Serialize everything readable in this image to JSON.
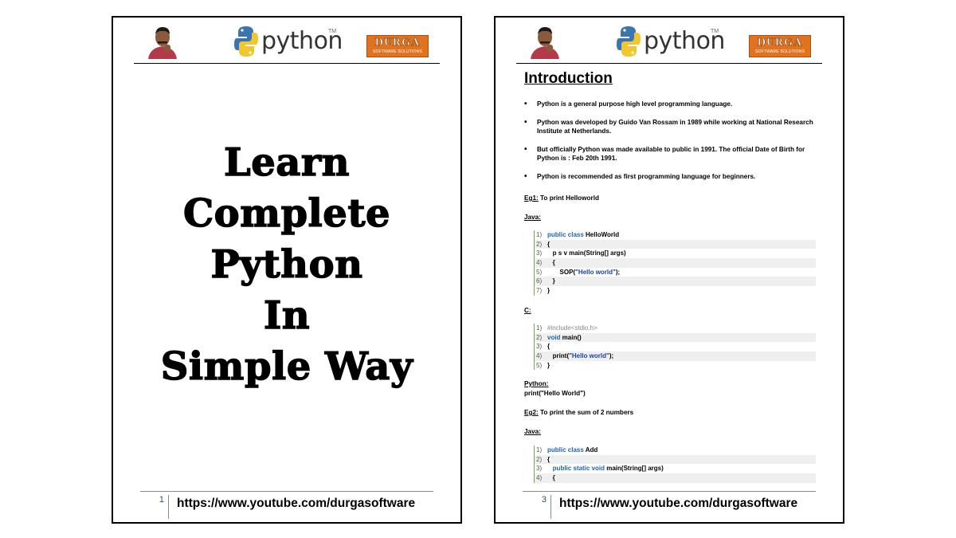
{
  "brand": {
    "python_word": "python",
    "python_tm": "TM",
    "durga_main": "DURGA",
    "durga_sub": "SOFTWARE SOLUTIONS",
    "colors": {
      "durga_orange": "#e0731f",
      "code_keyword": "#2064b4",
      "code_rule": "#6cb04a"
    }
  },
  "footer": {
    "url": "https://www.youtube.com/durgasoftware"
  },
  "left_page": {
    "page_number": "1",
    "title_lines": [
      "Learn",
      "Complete",
      "Python",
      "In",
      "Simple Way"
    ]
  },
  "right_page": {
    "page_number": "3",
    "heading": "Introduction",
    "bullets": [
      "Python is a general purpose high level programming language.",
      "Python was developed by Guido Van Rossam in 1989 while working at National Research Institute at Netherlands.",
      "But officially Python was made available to public in 1991. The official Date of Birth for Python is : Feb 20th 1991.",
      "Python is recommended as first programming language for beginners."
    ],
    "eg1_label": "Eg1:",
    "eg1_text": " To print Helloworld",
    "java_label": "Java:",
    "java_code": [
      {
        "n": "1",
        "pre": "",
        "kw": "public class",
        "rest": " HelloWorld",
        "str": "",
        "post": ""
      },
      {
        "n": "2",
        "pre": "{",
        "kw": "",
        "rest": "",
        "str": "",
        "post": ""
      },
      {
        "n": "3",
        "pre": "   p s v main(String[] args)",
        "kw": "",
        "rest": "",
        "str": "",
        "post": ""
      },
      {
        "n": "4",
        "pre": "   {",
        "kw": "",
        "rest": "",
        "str": "",
        "post": ""
      },
      {
        "n": "5",
        "pre": "       SOP(",
        "kw": "",
        "rest": "",
        "str": "\"Hello world\"",
        "post": ");"
      },
      {
        "n": "6",
        "pre": "   }",
        "kw": "",
        "rest": "",
        "str": "",
        "post": ""
      },
      {
        "n": "7",
        "pre": "}",
        "kw": "",
        "rest": "",
        "str": "",
        "post": ""
      }
    ],
    "c_label": "C:",
    "c_code": [
      {
        "n": "1",
        "dim": "#include<stdio.h>",
        "pre": "",
        "kw": "",
        "rest": "",
        "str": "",
        "post": ""
      },
      {
        "n": "2",
        "dim": "",
        "pre": "",
        "kw": "void",
        "rest": " main()",
        "str": "",
        "post": ""
      },
      {
        "n": "3",
        "dim": "",
        "pre": "{",
        "kw": "",
        "rest": "",
        "str": "",
        "post": ""
      },
      {
        "n": "4",
        "dim": "",
        "pre": "   print(",
        "kw": "",
        "rest": "",
        "str": "\"Hello world\"",
        "post": ");"
      },
      {
        "n": "5",
        "dim": "",
        "pre": "}",
        "kw": "",
        "rest": "",
        "str": "",
        "post": ""
      }
    ],
    "python_label": "Python:",
    "python_code": "print(\"Hello World\")",
    "eg2_label": "Eg2:",
    "eg2_text": " To print the sum of 2 numbers",
    "java2_label": "Java:",
    "java2_code": [
      {
        "n": "1",
        "pre": "",
        "kw": "public class",
        "rest": " Add",
        "str": "",
        "post": ""
      },
      {
        "n": "2",
        "pre": "{",
        "kw": "",
        "rest": "",
        "str": "",
        "post": ""
      },
      {
        "n": "3",
        "pre": "   ",
        "kw": "public static void",
        "rest": " main(String[] args)",
        "str": "",
        "post": ""
      },
      {
        "n": "4",
        "pre": "   {",
        "kw": "",
        "rest": "",
        "str": "",
        "post": ""
      }
    ]
  }
}
